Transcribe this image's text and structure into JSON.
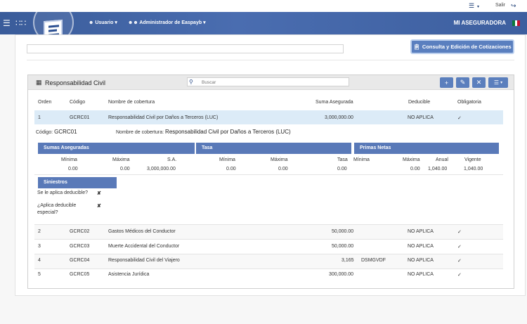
{
  "utility": {
    "logout_label": "Salir"
  },
  "nav": {
    "usuario_label": "Usuario",
    "admin_label": "Administrador de Easpayb",
    "brand": "MI ASEGURADORA"
  },
  "top": {
    "consult_button": "Consulta y Edición de Cotizaciones"
  },
  "panel": {
    "title": "Responsabilidad Civil",
    "search_placeholder": "Buscar"
  },
  "table": {
    "headers": {
      "orden": "Orden",
      "codigo": "Código",
      "nombre": "Nombre de cobertura",
      "suma": "Suma Asegurada",
      "deducible": "Deducible",
      "obligatoria": "Obligatoria"
    },
    "rows": [
      {
        "orden": "1",
        "codigo": "GCRC01",
        "nombre": "Responsabilidad Civil por Daños a Terceros (LUC)",
        "suma": "3,000,000.00",
        "extra": "",
        "deducible": "NO APLICA",
        "obligatoria": "✓"
      },
      {
        "orden": "2",
        "codigo": "GCRC02",
        "nombre": "Gastos Médicos del Conductor",
        "suma": "50,000.00",
        "extra": "",
        "deducible": "NO APLICA",
        "obligatoria": "✓"
      },
      {
        "orden": "3",
        "codigo": "GCRC03",
        "nombre": "Muerte Accidental del Conductor",
        "suma": "50,000.00",
        "extra": "",
        "deducible": "NO APLICA",
        "obligatoria": "✓"
      },
      {
        "orden": "4",
        "codigo": "GCRC04",
        "nombre": "Responsabilidad Civil del Viajero",
        "suma": "3,165",
        "extra": "DSMGVDF",
        "deducible": "NO APLICA",
        "obligatoria": "✓"
      },
      {
        "orden": "5",
        "codigo": "GCRC05",
        "nombre": "Asistencia Jurídica",
        "suma": "300,000.00",
        "extra": "",
        "deducible": "NO APLICA",
        "obligatoria": "✓"
      }
    ]
  },
  "detail": {
    "codigo_label": "Código:",
    "codigo_value": "GCRC01",
    "nombre_label": "Nombre de cobertura:",
    "nombre_value": "Responsabilidad Civil por Daños a Terceros (LUC)",
    "sumas_header": "Sumas Aseguradas",
    "tasa_header": "Tasa",
    "primas_header": "Primas Netas",
    "sumas": {
      "minima_label": "Mínima",
      "maxima_label": "Máxima",
      "sa_label": "S.A.",
      "minima": "0.00",
      "maxima": "0.00",
      "sa": "3,000,000.00"
    },
    "tasa": {
      "minima_label": "Mínima",
      "maxima_label": "Máxima",
      "tasa_label": "Tasa",
      "minima": "0.00",
      "maxima": "0.00",
      "tasa": "0.00"
    },
    "primas": {
      "minima_label": "Mínima",
      "maxima_label": "Máxima",
      "anual_label": "Anual",
      "vigente_label": "Vigente",
      "minima": "0.00",
      "maxima": "0.00",
      "anual": "1,040.00",
      "vigente": "1,040.00"
    },
    "siniestros_header": "Siniestros",
    "deducible_q": "Se le aplica deducible?",
    "deducible_a": "✘",
    "especial_q1": "¿Aplica deducible",
    "especial_q2": "especial?",
    "especial_a": "✘"
  },
  "colors": {
    "topbar": "#4a6db0",
    "accent": "#5979b8",
    "highlight": "#dcebf7"
  }
}
